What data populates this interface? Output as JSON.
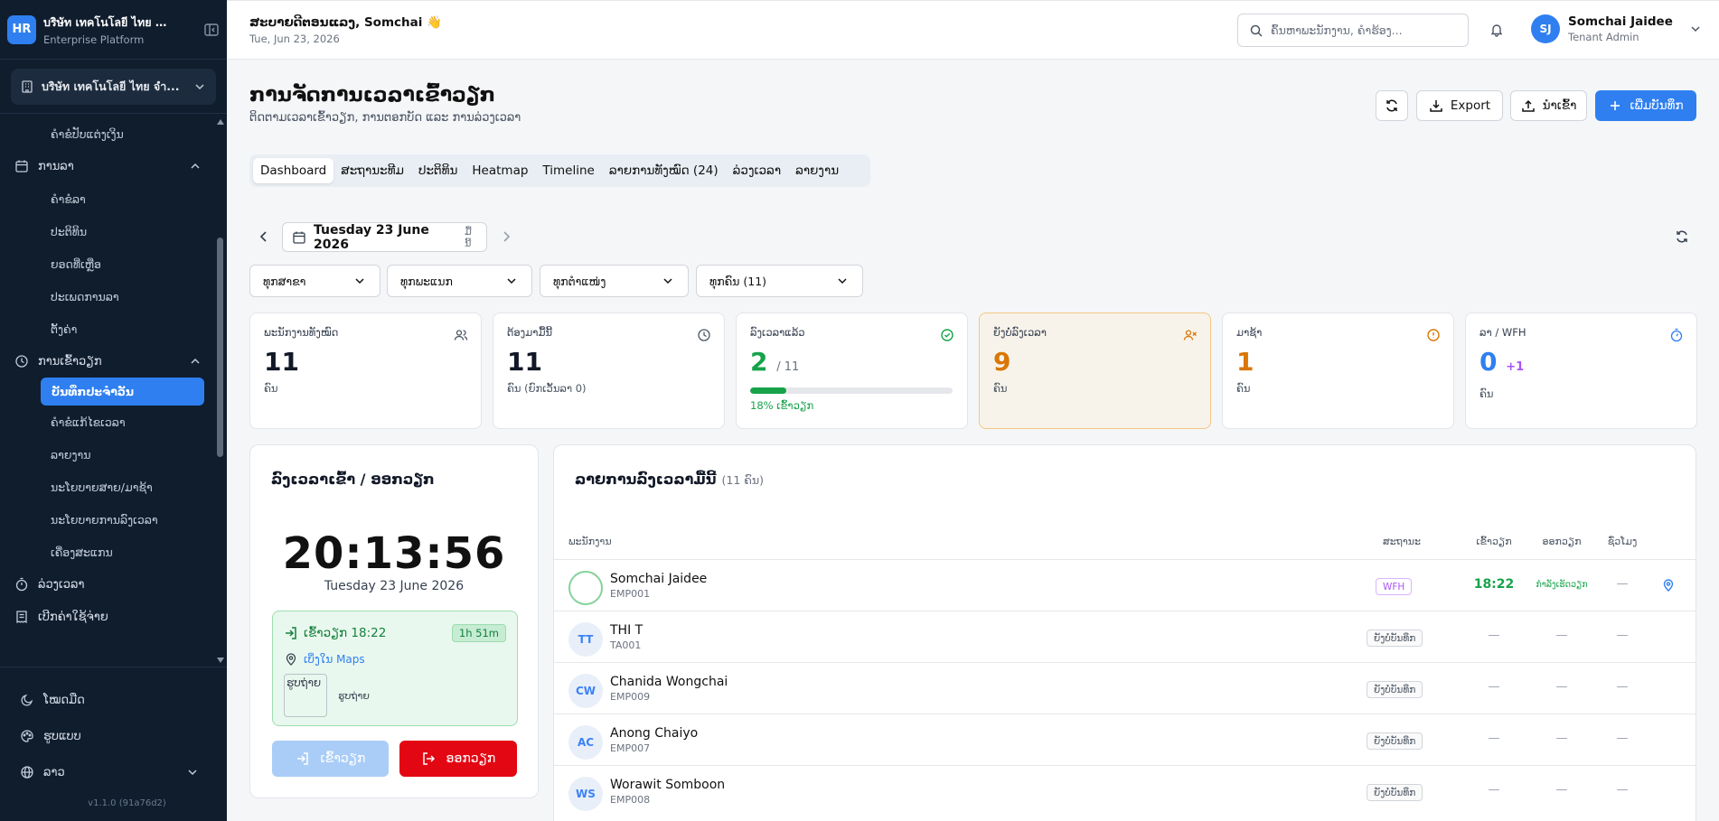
{
  "sidebar": {
    "logo": "HR",
    "company": "บริษัท เทคโนโลยี ไทย จำกัด",
    "platform": "Enterprise Platform",
    "tenant": "บริษัท เทคโนโลยี ไทย จำ...",
    "nav": {
      "sub_top": "ຄຳຂໍປັບແຕ່ງເງິນ",
      "leave_label": "ການລາ",
      "leave_items": [
        "ຄຳຂໍລາ",
        "ປະຕິທິນ",
        "ຍອດທີ່ເຫຼືອ",
        "ປະເພດການລາ",
        "ຕັ້ງຄ່າ"
      ],
      "attendance_label": "ການເຂົ້າວຽກ",
      "attendance_items": [
        "ບັນທຶກປະຈຳວັນ",
        "ຄຳຂໍແກ້ໄຂເວລາ",
        "ລາຍງານ",
        "ນະໂຍບາຍສາຍ/ມາຊ້າ",
        "ນະໂຍບາຍການລົງເວລາ",
        "ເຄື່ອງສະແກນ"
      ],
      "overtime_label": "ລ່ວງເວລາ",
      "expense_label": "ເບີກຄ່າໃຊ້ຈ່າຍ"
    },
    "bottom": {
      "dark_mode": "ໂໝດມືດ",
      "theme": "ຮູບແບບ",
      "language": "ລາວ"
    },
    "version": "v1.1.0 (91a76d2)"
  },
  "topbar": {
    "greeting": "ສະບາຍດີຕອນແລງ, Somchai 👋",
    "date": "Tue, Jun 23, 2026",
    "search_placeholder": "ຄົ້ນຫາພະນັກງານ, ຄຳຮ້ອງ...",
    "user_initials": "SJ",
    "user_name": "Somchai Jaidee",
    "user_role": "Tenant Admin"
  },
  "page": {
    "title": "ການຈັດການເວລາເຂົ້າວຽກ",
    "subtitle": "ຕິດຕາມເວລາເຂົ້າວຽກ, ການຕອກບັດ ແລະ ການລ່ວງເວລາ",
    "export_label": "Export",
    "import_label": "ນຳເຂົ້າ",
    "add_label": "ເພີ່ມບັນທຶກ"
  },
  "tabs": [
    "Dashboard",
    "ສະຖານະທີມ",
    "ປະຕິທິນ",
    "Heatmap",
    "Timeline",
    "ລາຍການທັງໝົດ (24)",
    "ລ່ວງເວລາ",
    "ລາຍງານ"
  ],
  "date_nav": {
    "date": "Tuesday 23 June 2026",
    "suffix": "ມື້ນີ້"
  },
  "filters": [
    "ທຸກສາຂາ",
    "ທຸກພະແນກ",
    "ທຸກຕຳແໜ່ງ",
    "ທຸກຄົນ (11)"
  ],
  "stats": [
    {
      "title": "ພະນັກງານທັງໝົດ",
      "value": "11",
      "unit": "ຄົນ",
      "color": "#111827"
    },
    {
      "title": "ຕ້ອງມາມື້ນີ້",
      "value": "11",
      "unit": "ຄົນ (ຍົກເວັ້ນລາ 0)",
      "color": "#111827"
    },
    {
      "title": "ລົງເວລາແລ້ວ",
      "value": "2",
      "of": "/ 11",
      "unit": "18% ເຂົ້າວຽກ",
      "progress": 0.18,
      "color": "#16a34a"
    },
    {
      "title": "ຍັງບໍ່ລົງເວລາ",
      "value": "9",
      "unit": "ຄົນ",
      "color": "#d97706"
    },
    {
      "title": "ມາຊ້າ",
      "value": "1",
      "unit": "ຄົນ",
      "color": "#d97706"
    },
    {
      "title": "ລາ / WFH",
      "value": "0",
      "extra": "+1",
      "unit": "ຄົນ",
      "color": "#2f7ff0"
    }
  ],
  "clock": {
    "title": "ລົງເວລາເຂົ້າ / ອອກວຽກ",
    "time": "20:13:56",
    "date": "Tuesday 23 June 2026",
    "checkin_label": "ເຂົ້າວຽກ 18:22",
    "duration": "1h 51m",
    "map_link": "ເບິ່ງໃນ Maps",
    "photo_alt": "ຮູບຖ່າຍ",
    "photo_caption": "ຮູບຖ່າຍ",
    "checkin_btn": "ເຂົ້າວຽກ",
    "checkout_btn": "ອອກວຽກ"
  },
  "table": {
    "title": "ລາຍການລົງເວລາມື້ນີ້",
    "count": "(11 ຄົນ)",
    "headers": {
      "employee": "ພະນັກງານ",
      "status": "ສະຖານະ",
      "in": "ເຂົ້າວຽກ",
      "out": "ອອກວຽກ",
      "hours": "ຊົ່ວໂມງ"
    },
    "rows": [
      {
        "initials": "",
        "name": "Somchai Jaidee",
        "code": "EMP001",
        "status": "WFH",
        "in": "18:22",
        "out": "ກຳລັງເຮັດວຽກ",
        "hours": "—"
      },
      {
        "initials": "TT",
        "name": "THI T",
        "code": "TA001",
        "status": "ຍັງບໍ່ບັນທຶກ",
        "in": "—",
        "out": "—",
        "hours": "—"
      },
      {
        "initials": "CW",
        "name": "Chanida Wongchai",
        "code": "EMP009",
        "status": "ຍັງບໍ່ບັນທຶກ",
        "in": "—",
        "out": "—",
        "hours": "—"
      },
      {
        "initials": "AC",
        "name": "Anong Chaiyo",
        "code": "EMP007",
        "status": "ຍັງບໍ່ບັນທຶກ",
        "in": "—",
        "out": "—",
        "hours": "—"
      },
      {
        "initials": "WS",
        "name": "Worawit Somboon",
        "code": "EMP008",
        "status": "ຍັງບໍ່ບັນທຶກ",
        "in": "—",
        "out": "—",
        "hours": "—"
      }
    ]
  }
}
